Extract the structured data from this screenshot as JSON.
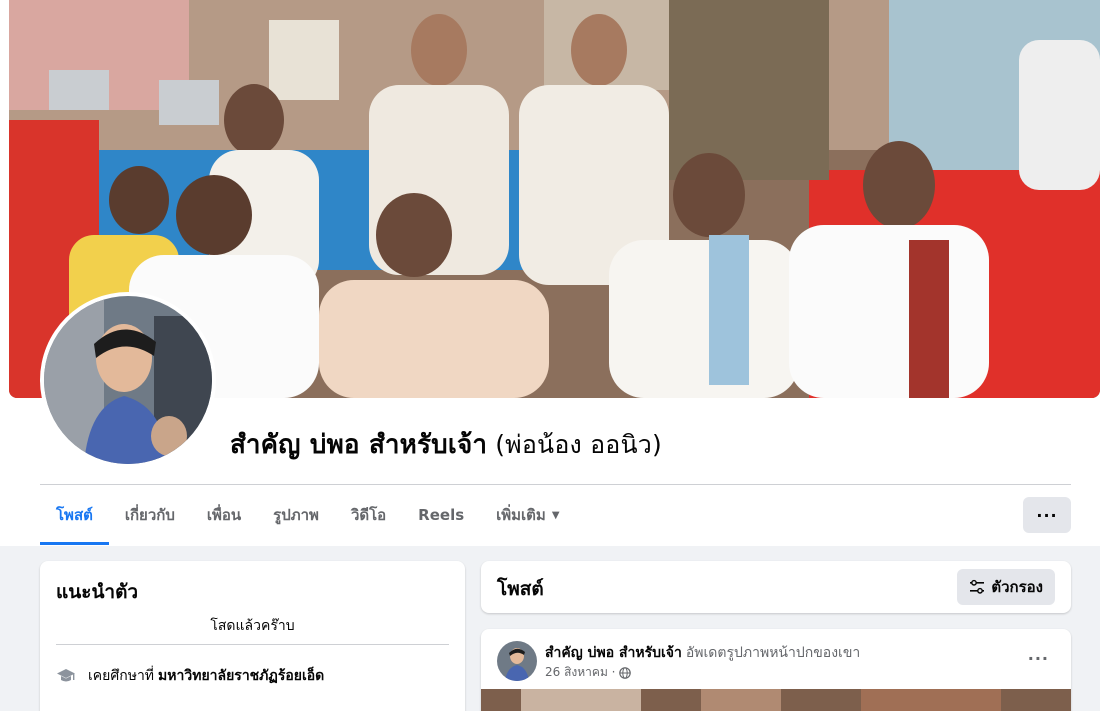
{
  "profile": {
    "name": "สำคัญ บ่พอ สำหรับเจ้า",
    "alternate_name": "(พ่อน้อง ออนิว)"
  },
  "tabs": [
    {
      "label": "โพสต์",
      "active": true
    },
    {
      "label": "เกี่ยวกับ",
      "active": false
    },
    {
      "label": "เพื่อน",
      "active": false
    },
    {
      "label": "รูปภาพ",
      "active": false
    },
    {
      "label": "วิดีโอ",
      "active": false
    },
    {
      "label": "Reels",
      "active": false
    },
    {
      "label": "เพิ่มเติม",
      "active": false
    }
  ],
  "more_menu": {
    "label": "···"
  },
  "intro": {
    "title": "แนะนำตัว",
    "bio": "โสดแล้วคร๊าบ",
    "education_prefix": "เคยศึกษาที่",
    "education_school": "มหาวิทยาลัยราชภัฏร้อยเอ็ด",
    "education_icon": "graduation-cap-icon"
  },
  "posts_section": {
    "title": "โพสต์",
    "filter_label": "ตัวกรอง",
    "filter_icon": "sliders-icon"
  },
  "post": {
    "author": "สำคัญ บ่พอ สำหรับเจ้า",
    "action": "อัพเดตรูปภาพหน้าปกของเขา",
    "date": "26 สิงหาคม ·",
    "privacy_icon": "globe-icon",
    "more_label": "···"
  },
  "colors": {
    "accent": "#1877f2",
    "background": "#f0f2f5",
    "secondary_text": "#65676b",
    "button_gray": "#e4e6eb"
  }
}
